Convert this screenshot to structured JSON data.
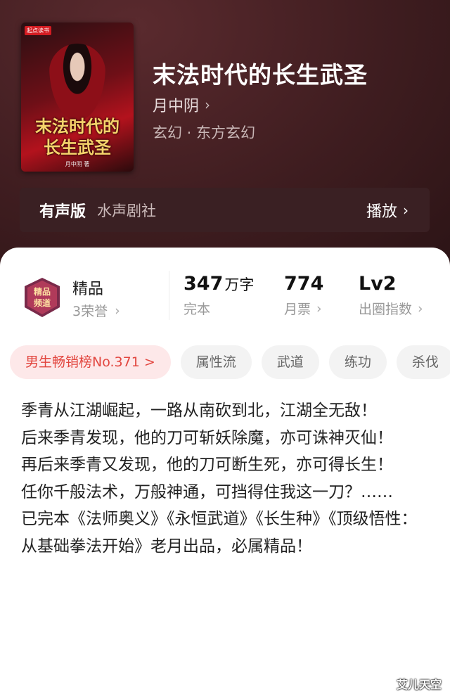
{
  "book": {
    "publisher": "起点读书",
    "cover_title_line1": "末法时代的",
    "cover_title_line2": "长生武圣",
    "cover_author": "月中阴 著",
    "title": "末法时代的长生武圣",
    "author": "月中阴",
    "genre": "玄幻 · 东方玄幻"
  },
  "audio": {
    "label": "有声版",
    "studio": "水声剧社",
    "play_label": "播放"
  },
  "quality": {
    "badge_line1": "精品",
    "badge_line2": "频道",
    "label": "精品",
    "honors": "3荣誉"
  },
  "stats": [
    {
      "value": "347",
      "unit": "万字",
      "label": "完本"
    },
    {
      "value": "774",
      "unit": "",
      "label": "月票"
    },
    {
      "value": "Lv2",
      "unit": "",
      "label": "出圈指数"
    }
  ],
  "tags": [
    "男生畅销榜No.371 >",
    "属性流",
    "武道",
    "练功",
    "杀伐"
  ],
  "description": [
    "季青从江湖崛起，一路从南砍到北，江湖全无敌！",
    "后来季青发现，他的刀可斩妖除魔，亦可诛神灭仙！",
    "再后来季青又发现，他的刀可断生死，亦可得长生！",
    "任你千般法术，万般神通，可挡得住我这一刀？……",
    "已完本《法师奥义》《永恒武道》《长生种》《顶级悟性：从基础拳法开始》老月出品，必属精品！"
  ],
  "watermark": "艾儿天空",
  "colors": {
    "hero_bg": "#3f1d20",
    "accent_red": "#e2463f",
    "cover_gold": "#f6d36b"
  }
}
